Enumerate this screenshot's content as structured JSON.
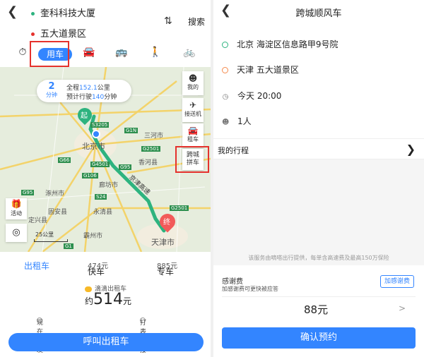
{
  "left": {
    "route": {
      "from": "奎科科技大厦",
      "to": "五大道景区"
    },
    "search_label": "搜索",
    "swap_glyph": "⇅",
    "modes": {
      "active_label": "用车"
    },
    "map": {
      "trip_card": {
        "minutes": "2",
        "minutes_unit": "分钟",
        "distance_prefix": "全程",
        "distance_value": "152.1",
        "distance_unit": "公里",
        "time_prefix": "预计行驶",
        "time_value": "140",
        "time_unit": "分钟"
      },
      "start_label": "起",
      "end_label": "终",
      "place_labels": [
        "北京市",
        "三河市",
        "香河县",
        "廊坊市",
        "永清县",
        "涿州市",
        "固安县",
        "定兴县",
        "霸州市",
        "天津市",
        "京津高速"
      ],
      "road_labels": [
        "S3205",
        "G1N",
        "G4501",
        "G95",
        "G66",
        "G106",
        "S24",
        "G2501",
        "G6",
        "G95",
        "G1",
        "G2501"
      ],
      "side_buttons": [
        {
          "icon": "person-icon",
          "label": "我的"
        },
        {
          "icon": "plane-icon",
          "label": "接送机"
        },
        {
          "icon": "car-icon",
          "label": "租车"
        },
        {
          "icon": "carpool-icon",
          "label": "跨城拼车"
        }
      ],
      "gift_label": "活动",
      "scale_label": "25公里"
    },
    "tabs": {
      "taxi": "出租车",
      "express": "快车",
      "express_price": "474元",
      "premium": "专车",
      "premium_price": "885元"
    },
    "provider": "滴滴出租车",
    "estimate_prefix": "约",
    "estimate_value": "514",
    "estimate_unit": "元",
    "options": {
      "now": "现在出发",
      "meter": "打表来接"
    },
    "call_button": "呼叫出租车",
    "colors": {
      "accent": "#3385ff",
      "highlight": "#e5322d",
      "route": "#2db37f",
      "start": "#2db37f",
      "end": "#f25a5a"
    }
  },
  "right": {
    "title": "跨城顺风车",
    "origin": "北京 海淀区信息路甲9号院",
    "destination": "天津 五大道景区",
    "time": "今天 20:00",
    "passengers": "1人",
    "my_trip": "我的行程",
    "service_note": "该服务由嘀嗒出行提供，每单含高速费及最高150万保险",
    "thanks_title": "感谢费",
    "thanks_sub": "加感谢费可更快被应答",
    "thanks_button": "加感谢费",
    "fare": "88元",
    "confirm_button": "确认预约",
    "colors": {
      "origin_ring": "#2db37f",
      "destination_ring": "#f58a4b"
    }
  }
}
